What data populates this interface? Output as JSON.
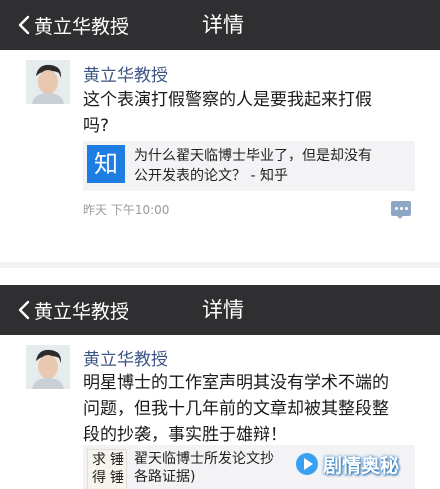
{
  "posts": [
    {
      "nav": {
        "back_label": "黄立华教授",
        "title": "详情"
      },
      "author": "黄立华教授",
      "body_lines": [
        "这个表演打假警察的人是要我起来打假",
        "吗?"
      ],
      "link": {
        "icon_char": "知",
        "lines": [
          "为什么翟天临博士毕业了，但是却没有",
          "公开发表的论文？ - 知乎"
        ]
      },
      "time": "昨天 下午10:00"
    },
    {
      "nav": {
        "back_label": "黄立华教授",
        "title": "详情"
      },
      "author": "黄立华教授",
      "body_lines": [
        "明星博士的工作室声明其没有学术不端的",
        "问题，但我十几年前的文章却被其整段整",
        "段的抄袭，事实胜于雄辩！"
      ],
      "attachment": {
        "thumb_chars": [
          "求",
          "锤",
          "得",
          "锤"
        ],
        "lines": [
          "翟天临博士所发论文抄",
          "各路证据)"
        ]
      }
    }
  ],
  "watermark": {
    "text": "剧情奥秘"
  },
  "colors": {
    "navbar": "#2f2f31",
    "author_name": "#3d5584",
    "zhihu_blue": "#1e7de0"
  },
  "icons": {
    "back": "chevron-left-icon",
    "comment": "comment-icon",
    "zhihu": "zhihu-logo-icon",
    "watermark": "play-circle-icon"
  }
}
